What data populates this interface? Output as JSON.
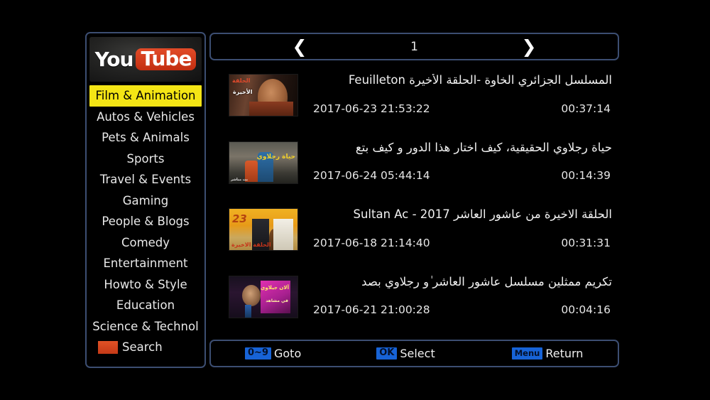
{
  "app": {
    "title": "YouTube",
    "logo_text_you": "You",
    "logo_text_tube": "Tube",
    "background_color": "#000000",
    "border_color": "#3c4e72",
    "highlight_color": "#f4e515",
    "badge_color": "#1763d6",
    "search_swatch_color": "#d4441f"
  },
  "sidebar": {
    "items": [
      {
        "label": "Film & Animation",
        "selected": true
      },
      {
        "label": "Autos & Vehicles",
        "selected": false
      },
      {
        "label": "Pets & Animals",
        "selected": false
      },
      {
        "label": "Sports",
        "selected": false
      },
      {
        "label": "Travel & Events",
        "selected": false
      },
      {
        "label": "Gaming",
        "selected": false
      },
      {
        "label": "People & Blogs",
        "selected": false
      },
      {
        "label": "Comedy",
        "selected": false
      },
      {
        "label": "Entertainment",
        "selected": false
      },
      {
        "label": "Howto & Style",
        "selected": false
      },
      {
        "label": "Education",
        "selected": false
      },
      {
        "label": "Science & Technol",
        "selected": false
      },
      {
        "label": "Search",
        "selected": false,
        "icon": "search-swatch-icon"
      }
    ]
  },
  "pager": {
    "prev_icon": "chevron-left-icon",
    "prev_glyph": "❮",
    "page_number": "1",
    "next_icon": "chevron-right-icon",
    "next_glyph": "❯"
  },
  "video_list": {
    "items": [
      {
        "title": "المسلسل الجزائري الخاوة  -الحلقة الأخيرة Feuilleton",
        "date": "2017-06-23 21:53:22",
        "duration": "00:37:14",
        "thumbnail": "thumbnail-older-man-dark-interior",
        "thumb_overlay_1": "الحلقة",
        "thumb_overlay_2": "الأخيرة"
      },
      {
        "title": "حياة رجلاوي الحقيقية، كيف اختار هذا الدور و كيف بتع",
        "date": "2017-06-24 05:44:14",
        "duration": "00:14:39",
        "thumbnail": "thumbnail-street-two-people",
        "thumb_overlay_1": "حياة رجلاوي",
        "thumb_overlay_2": "بث مباشر"
      },
      {
        "title": "الحلقة الاخيرة من عاشور العاشر Sultan Ac  -  2017",
        "date": "2017-06-18 21:14:40",
        "duration": "00:31:31",
        "thumbnail": "thumbnail-wedding-yellow-scene",
        "thumb_overlay_1": "23",
        "thumb_overlay_2": "الحلقة الاخيرة"
      },
      {
        "title": "تكريم ممثلين مسلسل عاشور العاشر ٰو رجلاوي بصد",
        "date": "2017-06-21 21:00:28",
        "duration": "00:04:16",
        "thumbnail": "thumbnail-night-magenta-sign",
        "thumb_overlay_1": "ألان جيلاوي",
        "thumb_overlay_2": "في مشاهد"
      }
    ]
  },
  "hintbar": {
    "hints": [
      {
        "key": "0~9",
        "label": "Goto"
      },
      {
        "key": "OK",
        "label": "Select"
      },
      {
        "key": "Menu",
        "label": "Return"
      }
    ]
  }
}
